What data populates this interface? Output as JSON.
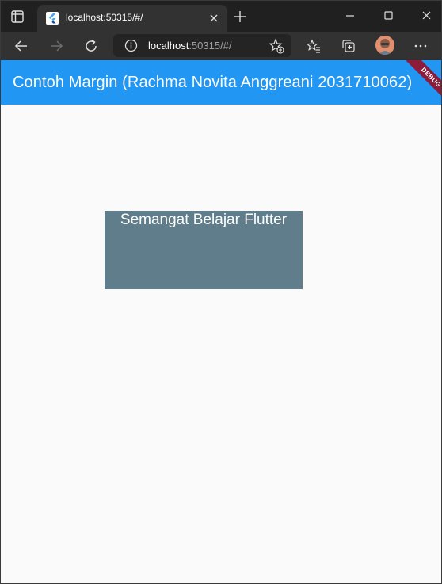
{
  "browser": {
    "tab": {
      "title": "localhost:50315/#/",
      "favicon": "flutter-icon"
    },
    "address": {
      "host": "localhost",
      "rest": ":50315/#/"
    },
    "icons": {
      "tab_actions": "tab-actions-icon",
      "close_tab": "close-icon",
      "new_tab": "plus-icon",
      "back": "back-arrow-icon",
      "forward": "forward-arrow-icon",
      "refresh": "refresh-icon",
      "site_info": "info-icon",
      "add_favorite": "star-plus-icon",
      "favorites": "favorites-icon",
      "collections": "collections-icon",
      "profile": "avatar",
      "menu": "more-icon",
      "minimize": "minimize-icon",
      "maximize": "maximize-icon",
      "close_window": "close-icon"
    },
    "colors": {
      "tabbar": "#202020",
      "toolbar": "#323232"
    }
  },
  "app": {
    "appbar_title": "Contoh Margin (Rachma Novita Anggreani 2031710062)",
    "debug_banner": "DEBUG",
    "box_text": "Semangat Belajar Flutter",
    "colors": {
      "appbar": "#2196f3",
      "box": "#607d8b",
      "background": "#fafafa",
      "debug_banner": "#8b1c3c"
    }
  }
}
